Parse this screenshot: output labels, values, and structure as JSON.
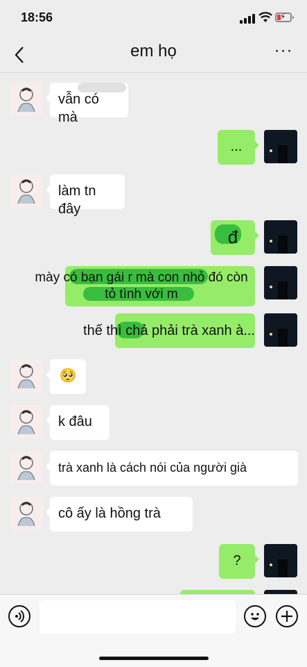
{
  "status_bar": {
    "time": "18:56"
  },
  "nav": {
    "title": "em họ",
    "back_icon": "chevron-left-icon",
    "more_icon": "more-dots-icon",
    "more_label": "···"
  },
  "messages": [
    {
      "side": "left",
      "text": "vẫn có mà"
    },
    {
      "side": "right",
      "text": "..."
    },
    {
      "side": "left",
      "text": "làm tn đây"
    },
    {
      "side": "right",
      "text": "đ"
    },
    {
      "side": "right",
      "text": "mày có bạn gái r mà con nhỏ đó còn tỏ tình với m"
    },
    {
      "side": "right",
      "text": "thế thì chả phải trà xanh à..."
    },
    {
      "side": "left",
      "text": "🥺",
      "type": "emoji"
    },
    {
      "side": "left",
      "text": "k đâu"
    },
    {
      "side": "left",
      "text": "trà xanh là cách nói của người già"
    },
    {
      "side": "left",
      "text": "cô ấy là hồng trà"
    },
    {
      "side": "right",
      "text": "?"
    }
  ],
  "input_bar": {
    "voice_icon": "voice-icon",
    "emoji_icon": "emoji-icon",
    "plus_icon": "plus-icon",
    "placeholder": ""
  },
  "colors": {
    "background": "#ededed",
    "incoming_bubble": "#ffffff",
    "outgoing_bubble": "#95ec69",
    "scribble": "#2fb83a"
  }
}
